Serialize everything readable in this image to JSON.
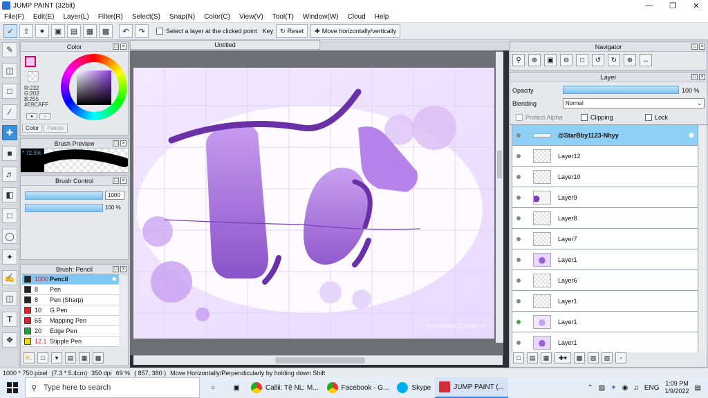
{
  "window": {
    "title": "JUMP PAINT (32bit)"
  },
  "menu": [
    "File(F)",
    "Edit(E)",
    "Layer(L)",
    "Filter(R)",
    "Select(S)",
    "Snap(N)",
    "Color(C)",
    "View(V)",
    "Tool(T)",
    "Window(W)",
    "Cloud",
    "Help"
  ],
  "toolbar": {
    "select_layer_label": "Select a layer at the clicked point",
    "key_label": "Key",
    "reset_label": "Reset",
    "move_label": "Move horizontally/vertically"
  },
  "color_panel": {
    "title": "Color",
    "rgb_lines": [
      "R:232",
      "G:202",
      "B:255",
      "#E8CAFF"
    ],
    "tabs": [
      "Color",
      "Palette"
    ]
  },
  "brush_preview": {
    "title": "Brush Preview",
    "percent": "* 72.5%"
  },
  "brush_control": {
    "title": "Brush Control",
    "size_value": "1000",
    "opacity_value": "100 %"
  },
  "brush_list": {
    "title": "Brush: Pencil",
    "items": [
      {
        "size": "1000",
        "name": "Pencil",
        "color": "#222222"
      },
      {
        "size": "8",
        "name": "Pen",
        "color": "#222222"
      },
      {
        "size": "8",
        "name": "Pen (Sharp)",
        "color": "#222222"
      },
      {
        "size": "10",
        "name": "G Pen",
        "color": "#e0202a"
      },
      {
        "size": "65",
        "name": "Mapping Pen",
        "color": "#e0202a"
      },
      {
        "size": "20",
        "name": "Edge Pen",
        "color": "#1fa83a"
      },
      {
        "size": "12.1",
        "name": "Stipple Pen",
        "color": "#e8d81a"
      }
    ]
  },
  "canvas": {
    "doc_tab": "Untitled"
  },
  "navigator": {
    "title": "Navigator"
  },
  "layer_panel": {
    "title": "Layer",
    "opacity_label": "Opacity",
    "opacity_value": "100 %",
    "blending_label": "Blending",
    "blending_value": "Normal",
    "protect_alpha": "Protect Alpha",
    "clipping": "Clipping",
    "lock": "Lock",
    "layers": [
      {
        "name": "@StarBby1123-Nhyy",
        "selected": true
      },
      {
        "name": "Layer12"
      },
      {
        "name": "Layer10"
      },
      {
        "name": "Layer9"
      },
      {
        "name": "Layer8"
      },
      {
        "name": "Layer7"
      },
      {
        "name": "Layer1"
      },
      {
        "name": "Layer6"
      },
      {
        "name": "Layer1"
      },
      {
        "name": "Layer1"
      },
      {
        "name": "Layer1"
      }
    ]
  },
  "status": {
    "size": "1000 * 750 pixel",
    "physical": "(7.3 * 5.4cm)",
    "dpi": "350 dpi",
    "zoom": "69 %",
    "coords": "( 857, 380 )",
    "hint": "Move Horizontally/Perpendicularly by holding down Shift"
  },
  "taskbar": {
    "search_placeholder": "Type here to search",
    "items": [
      "Callii: Tệ NL: M...",
      "Facebook - G...",
      "Skype",
      "JUMP PAINT (..."
    ],
    "lang": "ENG",
    "time": "1:09 PM",
    "date": "1/9/2022"
  },
  "colors": {
    "accent": "#3d8fd9",
    "foreground_color": "#E8CAFF"
  }
}
